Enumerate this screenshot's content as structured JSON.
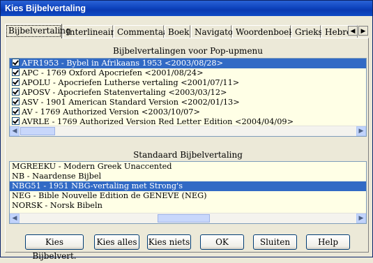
{
  "window": {
    "title": "Kies Bijbelvertaling"
  },
  "tabs": [
    {
      "label": "Bijbelvertaling",
      "active": true
    },
    {
      "label": "Interlineair"
    },
    {
      "label": "Commentaar"
    },
    {
      "label": "Boek"
    },
    {
      "label": "Navigator"
    },
    {
      "label": "Woordenboek"
    },
    {
      "label": "Grieks"
    },
    {
      "label": "Hebreeuw"
    }
  ],
  "popup_list": {
    "label": "Bijbelvertalingen voor Pop-upmenu",
    "items": [
      {
        "text": "AFR1953 - Bybel in Afrikaans 1953 <2003/08/28>",
        "checked": true,
        "selected": true
      },
      {
        "text": "APC - 1769 Oxford Apocriefen <2001/08/24>",
        "checked": true
      },
      {
        "text": "APOLU - Apocriefen Lutherse vertaling <2001/07/11>",
        "checked": true
      },
      {
        "text": "APOSV - Apocriefen Statenvertaling <2003/03/12>",
        "checked": true
      },
      {
        "text": "ASV - 1901 American Standard Version <2002/01/13>",
        "checked": true
      },
      {
        "text": "AV - 1769 Authorized Version <2003/10/07>",
        "checked": true
      },
      {
        "text": "AVRLE - 1769 Authorized Version Red Letter Edition <2004/04/09>",
        "checked": true
      }
    ]
  },
  "standard_list": {
    "label": "Standaard Bijbelvertaling",
    "items": [
      {
        "text": "MGREEKU - Modern Greek Unaccented"
      },
      {
        "text": "NB - Naardense Bijbel"
      },
      {
        "text": "NBG51 - 1951 NBG-vertaling met Strong's",
        "selected": true
      },
      {
        "text": "NEG - Bible Nouvelle Edition de GENEVE (NEG)"
      },
      {
        "text": "NORSK - Norsk Bibeln"
      }
    ]
  },
  "buttons": {
    "kies_bijbelvert": "Kies Bijbelvert.",
    "kies_alles": "Kies alles",
    "kies_niets": "Kies niets",
    "ok": "OK",
    "sluiten": "Sluiten",
    "help": "Help"
  },
  "colors": {
    "title_bar": "#0a3ab1",
    "selection": "#316ac5",
    "list_bg": "#ffffe6",
    "dialog_bg": "#ece9d8"
  }
}
